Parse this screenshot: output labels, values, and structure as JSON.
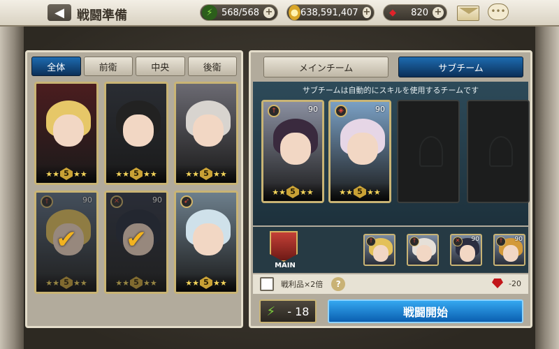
{
  "header": {
    "title": "戦闘準備",
    "back_icon": "arrow-left-icon",
    "stamina": "568/568",
    "gold": "638,591,407",
    "gems": "820",
    "plus": "+",
    "chat_icon_glyph": "•••"
  },
  "filters": [
    "全体",
    "前衛",
    "中央",
    "後衛"
  ],
  "active_filter": 0,
  "roster": [
    {
      "level": "",
      "rank": "5",
      "role": "",
      "hair": "#e6c768",
      "bg": "#4b1d1f",
      "checked": false
    },
    {
      "level": "",
      "rank": "5",
      "role": "",
      "hair": "#222222",
      "bg": "#2a2d33",
      "checked": false
    },
    {
      "level": "",
      "rank": "5",
      "role": "",
      "hair": "#d8d4cf",
      "bg": "#6b6a72",
      "checked": false
    },
    {
      "level": "90",
      "rank": "5",
      "role": "sword",
      "hair": "#e3c15a",
      "bg": "#5c6f86",
      "checked": true
    },
    {
      "level": "90",
      "rank": "5",
      "role": "cross",
      "hair": "#1f2738",
      "bg": "#2c3345",
      "checked": true
    },
    {
      "level": "",
      "rank": "5",
      "role": "bow",
      "hair": "#cfe1ea",
      "bg": "#6d7f8c",
      "checked": false
    }
  ],
  "team_tabs": {
    "main": "メインチーム",
    "sub": "サブチーム",
    "active": "sub"
  },
  "team_description": "サブチームは自動的にスキルを使用するチームです",
  "sub_team": [
    {
      "level": "90",
      "rank": "5",
      "role": "sword",
      "hair": "#3a2a3e",
      "bg": "#8a8fa0"
    },
    {
      "level": "90",
      "rank": "5",
      "role": "shield",
      "hair": "#e6d6e6",
      "bg": "#7aa0c4"
    }
  ],
  "main_label": "MAIN",
  "main_team": [
    {
      "level": "",
      "role": "sword",
      "hair": "#e3c15a"
    },
    {
      "level": "",
      "role": "sword",
      "hair": "#e6e0d8"
    },
    {
      "level": "90",
      "role": "cross",
      "hair": "#2a2d40"
    },
    {
      "level": "90",
      "role": "sword",
      "hair": "#d39a3a"
    }
  ],
  "loot_label": "戦利品×2倍",
  "loot_cost": "-20",
  "stamina_cost": "- 18",
  "battle_button": "戦闘開始",
  "colors": {
    "accent_blue": "#1d6bb0",
    "gold": "#c9b474",
    "gem_red": "#c2161a",
    "stamina_green": "#7dd23b"
  }
}
